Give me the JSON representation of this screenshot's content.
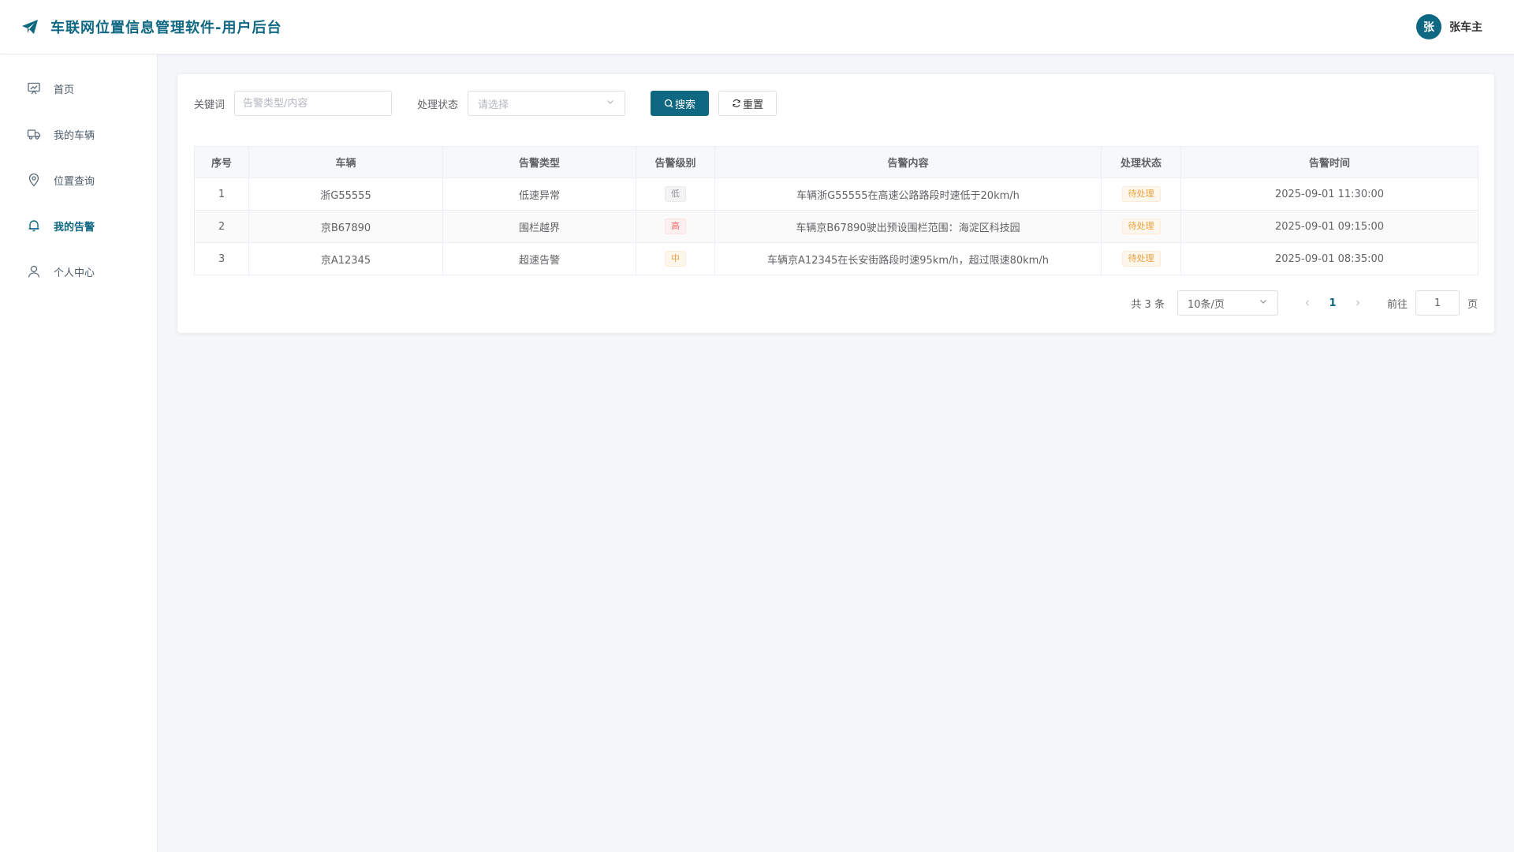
{
  "header": {
    "title": "车联网位置信息管理软件-用户后台",
    "logo_icon": "paper-plane-icon",
    "user_avatar_text": "张",
    "user_name": "张车主",
    "brand_color": "#0f6882"
  },
  "sidebar": {
    "items": [
      {
        "label": "首页",
        "icon": "dashboard-icon",
        "active": false
      },
      {
        "label": "我的车辆",
        "icon": "truck-icon",
        "active": false
      },
      {
        "label": "位置查询",
        "icon": "location-pin-icon",
        "active": false
      },
      {
        "label": "我的告警",
        "icon": "bell-icon",
        "active": true
      },
      {
        "label": "个人中心",
        "icon": "user-icon",
        "active": false
      }
    ]
  },
  "filters": {
    "keyword_label": "关键词",
    "keyword_placeholder": "告警类型/内容",
    "keyword_value": "",
    "status_label": "处理状态",
    "status_placeholder": "请选择",
    "search_label": "搜索",
    "reset_label": "重置"
  },
  "table": {
    "headers": [
      "序号",
      "车辆",
      "告警类型",
      "告警级别",
      "告警内容",
      "处理状态",
      "告警时间"
    ],
    "rows": [
      {
        "index": "1",
        "vehicle": "浙G55555",
        "type": "低速异常",
        "level": "低",
        "content": "车辆浙G55555在高速公路路段时速低于20km/h",
        "status": "待处理",
        "time": "2025-09-01 11:30:00"
      },
      {
        "index": "2",
        "vehicle": "京B67890",
        "type": "围栏越界",
        "level": "高",
        "content": "车辆京B67890驶出预设围栏范围：海淀区科技园",
        "status": "待处理",
        "time": "2025-09-01 09:15:00"
      },
      {
        "index": "3",
        "vehicle": "京A12345",
        "type": "超速告警",
        "level": "中",
        "content": "车辆京A12345在长安街路段时速95km/h，超过限速80km/h",
        "status": "待处理",
        "time": "2025-09-01 08:35:00"
      }
    ]
  },
  "pagination": {
    "total_text": "共 3 条",
    "page_size": "10条/页",
    "current_page": "1",
    "goto_prefix": "前往",
    "goto_value": "1",
    "goto_suffix": "页"
  }
}
